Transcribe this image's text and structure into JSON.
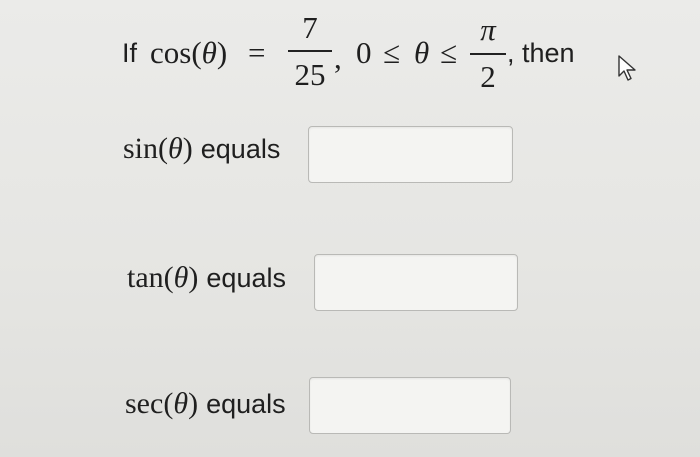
{
  "question": {
    "prefix": "If",
    "func": "cos",
    "open_paren": "(",
    "theta": "θ",
    "close_paren": ")",
    "equals_sign": "=",
    "numerator": "7",
    "denominator": "25",
    "comma": ",",
    "lower_bound": "0",
    "leq": "≤",
    "pi": "π",
    "upper_den": "2",
    "suffix": ", then"
  },
  "rows": [
    {
      "func": "sin",
      "theta": "θ",
      "word": "equals",
      "value": ""
    },
    {
      "func": "tan",
      "theta": "θ",
      "word": "equals",
      "value": ""
    },
    {
      "func": "sec",
      "theta": "θ",
      "word": "equals",
      "value": ""
    }
  ],
  "icons": {
    "cursor": "mouse-pointer-icon"
  }
}
